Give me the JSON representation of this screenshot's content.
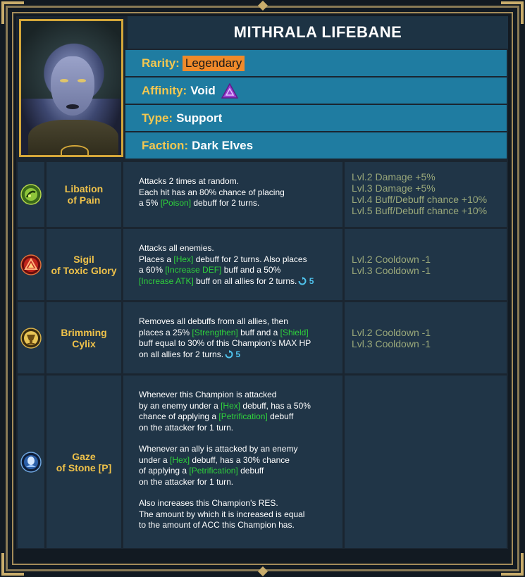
{
  "champion": {
    "name": "MITHRALA LIFEBANE",
    "rarity_label": "Rarity:",
    "rarity": "Legendary",
    "affinity_label": "Affinity:",
    "affinity": "Void",
    "type_label": "Type:",
    "type": "Support",
    "faction_label": "Faction:",
    "faction": "Dark Elves"
  },
  "colors": {
    "accent_gold": "#efc24a",
    "legendary": "#f08a2a",
    "buff_green": "#2fd13c",
    "cooldown_blue": "#4fc2ec",
    "void_purple": "#9b3fd0"
  },
  "skills": [
    {
      "icon": "libation-icon",
      "name_line1": "Libation",
      "name_line2": "of Pain",
      "desc": {
        "l1": "Attacks 2 times at random.",
        "l2": "Each hit has an 80% chance of placing",
        "l3a": "a 5% ",
        "l3b": "[Poison]",
        "l3c": " debuff for 2 turns."
      },
      "upgrades": [
        "Lvl.2 Damage +5%",
        "Lvl.3 Damage +5%",
        "Lvl.4 Buff/Debuff chance +10%",
        "Lvl.5 Buff/Debuff chance +10%"
      ]
    },
    {
      "icon": "sigil-icon",
      "name_line1": "Sigil",
      "name_line2": "of Toxic Glory",
      "desc": {
        "l1": "Attacks all enemies.",
        "l2a": "Places a ",
        "l2b": "[Hex]",
        "l2c": " debuff for 2 turns. Also places",
        "l3a": "a 60% ",
        "l3b": "[Increase DEF]",
        "l3c": " buff and a 50%",
        "l4a": "[Increase ATK]",
        "l4b": " buff on all allies for 2 turns.",
        "cooldown": "5"
      },
      "upgrades": [
        "Lvl.2 Cooldown -1",
        "Lvl.3 Cooldown -1"
      ]
    },
    {
      "icon": "cylix-icon",
      "name_line1": "Brimming",
      "name_line2": "Cylix",
      "desc": {
        "l1": "Removes all debuffs from all allies, then",
        "l2a": "places a 25% ",
        "l2b": "[Strengthen]",
        "l2c": " buff and a ",
        "l2d": "[Shield]",
        "l3": "buff equal to 30% of this Champion's MAX HP",
        "l4": "on all allies for 2 turns.",
        "cooldown": "5"
      },
      "upgrades": [
        "Lvl.2 Cooldown -1",
        "Lvl.3 Cooldown -1"
      ]
    },
    {
      "icon": "gaze-icon",
      "name_line1": "Gaze",
      "name_line2": "of Stone [P]",
      "desc": {
        "p1l1": "Whenever this Champion is attacked",
        "p1l2a": "by an enemy under a ",
        "p1l2b": "[Hex]",
        "p1l2c": " debuff, has a 50%",
        "p1l3a": "chance of applying a ",
        "p1l3b": "[Petrification]",
        "p1l3c": " debuff",
        "p1l4": "on the attacker for 1 turn.",
        "p2l1": "Whenever an ally is attacked by an enemy",
        "p2l2a": "under a ",
        "p2l2b": "[Hex]",
        "p2l2c": " debuff, has a 30% chance",
        "p2l3a": "of applying a ",
        "p2l3b": "[Petrification]",
        "p2l3c": " debuff",
        "p2l4": "on the attacker for 1 turn.",
        "p3l1": "Also increases this Champion's RES.",
        "p3l2": "The amount by which it is increased is equal",
        "p3l3": "to the amount of ACC this Champion has."
      },
      "upgrades": []
    }
  ]
}
